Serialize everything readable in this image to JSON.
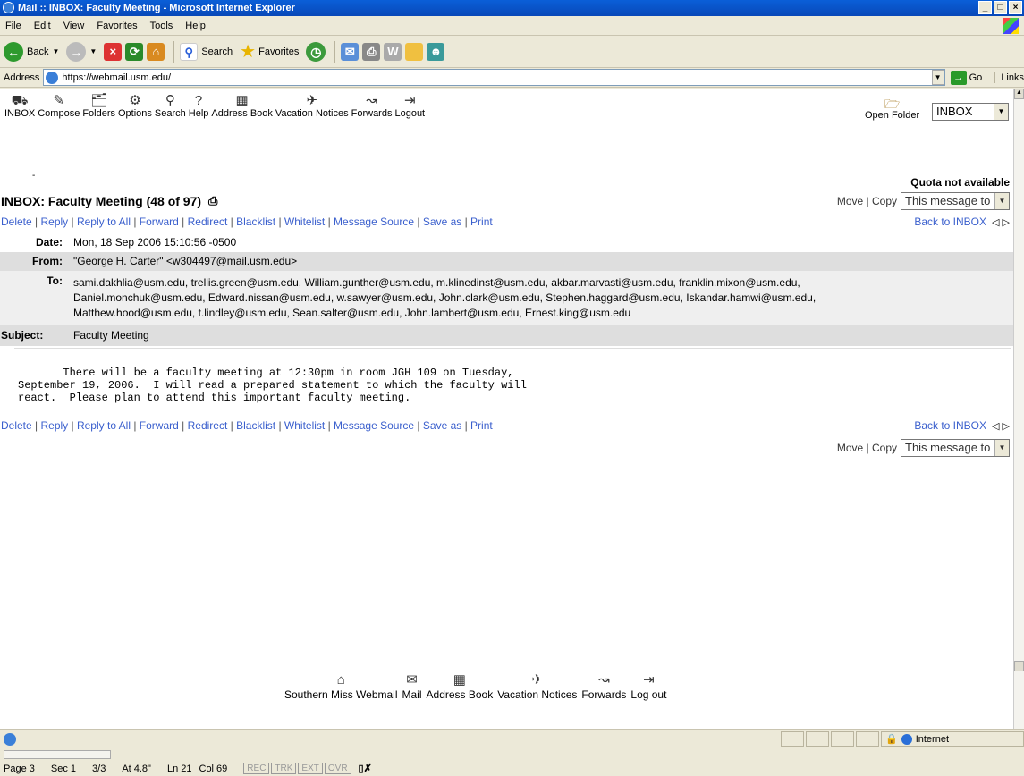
{
  "window": {
    "title": "Mail :: INBOX: Faculty Meeting - Microsoft Internet Explorer"
  },
  "menu": [
    "File",
    "Edit",
    "View",
    "Favorites",
    "Tools",
    "Help"
  ],
  "toolbar": {
    "back": "Back",
    "search": "Search",
    "favorites": "Favorites"
  },
  "address": {
    "label": "Address",
    "url": "https://webmail.usm.edu/",
    "go": "Go",
    "links": "Links"
  },
  "mailnav": [
    {
      "label": "INBOX",
      "icon": "inbox-icon",
      "glyph": "⛟"
    },
    {
      "label": "Compose",
      "icon": "compose-icon",
      "glyph": "✎"
    },
    {
      "label": "Folders",
      "icon": "folders-icon",
      "glyph": "🗂"
    },
    {
      "label": "Options",
      "icon": "options-icon",
      "glyph": "⚙"
    },
    {
      "label": "Search",
      "icon": "search-icon",
      "glyph": "⚲"
    },
    {
      "label": "Help",
      "icon": "help-icon",
      "glyph": "?"
    },
    {
      "label": "Address Book",
      "icon": "address-book-icon",
      "glyph": "▦"
    },
    {
      "label": "Vacation Notices",
      "icon": "vacation-icon",
      "glyph": "✈"
    },
    {
      "label": "Forwards",
      "icon": "forwards-icon",
      "glyph": "↝"
    },
    {
      "label": "Logout",
      "icon": "logout-icon",
      "glyph": "⇥"
    }
  ],
  "open_folder": "Open Folder",
  "folder_select": "INBOX",
  "quota": "Quota not available",
  "dash": "-",
  "message": {
    "title": "INBOX: Faculty Meeting (48 of 97)",
    "move": "Move",
    "copy": "Copy",
    "target": "This message to",
    "actions": [
      "Delete",
      "Reply",
      "Reply to All",
      "Forward",
      "Redirect",
      "Blacklist",
      "Whitelist",
      "Message Source",
      "Save as",
      "Print"
    ],
    "back": "Back to INBOX",
    "date_label": "Date:",
    "date": "Mon, 18 Sep 2006 15:10:56 -0500",
    "from_label": "From:",
    "from": "\"George H. Carter\" <w304497@mail.usm.edu>",
    "to_label": "To:",
    "to": [
      "sami.dakhlia@usm.edu, trellis.green@usm.edu, William.gunther@usm.edu, m.klinedinst@usm.edu, akbar.marvasti@usm.edu, franklin.mixon@usm.edu,",
      "Daniel.monchuk@usm.edu, Edward.nissan@usm.edu, w.sawyer@usm.edu, John.clark@usm.edu, Stephen.haggard@usm.edu, Iskandar.hamwi@usm.edu,",
      "Matthew.hood@usm.edu, t.lindley@usm.edu, Sean.salter@usm.edu, John.lambert@usm.edu, Ernest.king@usm.edu"
    ],
    "subject_label": "Subject:",
    "subject": "Faculty Meeting",
    "body": "       There will be a faculty meeting at 12:30pm in room JGH 109 on Tuesday,\nSeptember 19, 2006.  I will read a prepared statement to which the faculty will\nreact.  Please plan to attend this important faculty meeting."
  },
  "footer": [
    {
      "label": "Southern Miss Webmail",
      "icon": "home-icon",
      "glyph": "⌂"
    },
    {
      "label": "Mail",
      "icon": "mail-icon",
      "glyph": "✉"
    },
    {
      "label": "Address Book",
      "icon": "address-book-icon",
      "glyph": "▦"
    },
    {
      "label": "Vacation Notices",
      "icon": "vacation-icon",
      "glyph": "✈"
    },
    {
      "label": "Forwards",
      "icon": "forwards-icon",
      "glyph": "↝"
    },
    {
      "label": "Log out",
      "icon": "logout-icon",
      "glyph": "⇥"
    }
  ],
  "status": {
    "zone": "Internet"
  },
  "word": {
    "page": "Page 3",
    "sec": "Sec 1",
    "pages": "3/3",
    "at": "At 4.8\"",
    "ln": "Ln 21",
    "col": "Col 69",
    "modes": [
      "REC",
      "TRK",
      "EXT",
      "OVR"
    ]
  }
}
